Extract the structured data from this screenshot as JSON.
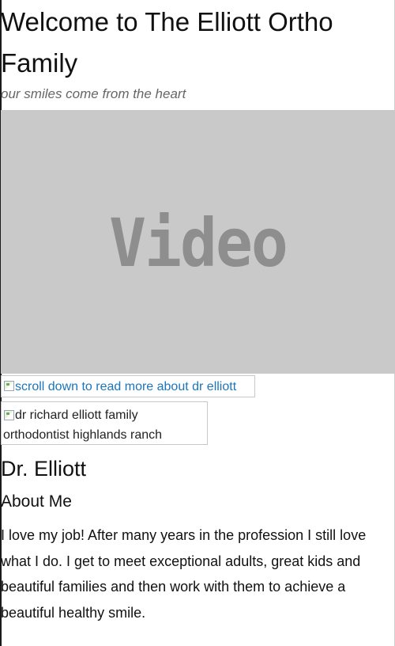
{
  "header": {
    "title": "Welcome to The Elliott Ortho Family",
    "tagline": "our smiles come from the heart"
  },
  "video": {
    "label": "Video"
  },
  "scroll_link": {
    "alt_text": "scroll down to read more about dr elliott",
    "icon": "broken-image-icon"
  },
  "doctor_image": {
    "alt_text": "dr richard elliott family orthodontist highlands ranch",
    "icon": "broken-image-icon"
  },
  "about": {
    "name": "Dr. Elliott",
    "heading": "About Me",
    "body": "I love my job! After many years in the profession I still love what I do. I get to meet exceptional adults, great kids and beautiful families and then work with them to achieve a beautiful healthy smile."
  },
  "colors": {
    "link": "#1a75bc",
    "tagline": "#666666",
    "video_bg": "#c9c9c9",
    "video_text": "#8e8e8e"
  }
}
